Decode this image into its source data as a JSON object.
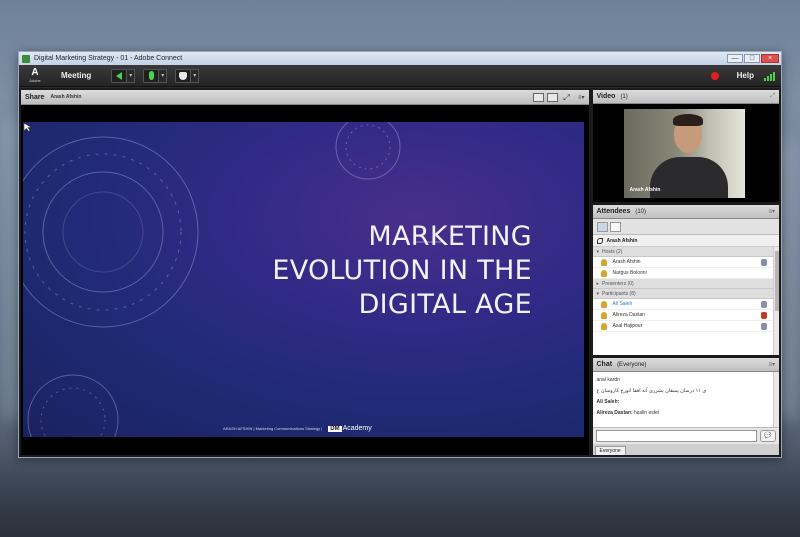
{
  "window": {
    "title": "Digital Marketing Strategy - 01 - Adobe Connect",
    "min_label": "—",
    "max_label": "□",
    "close_label": "×"
  },
  "menubar": {
    "adobe_mark": "A",
    "adobe_text": "Adobe",
    "meeting": "Meeting",
    "help": "Help",
    "record_color": "#e02020",
    "status_color": "#4dd04d"
  },
  "share": {
    "title": "Share",
    "presenter": "Arash Afshin",
    "menu_glyph": "≡▾"
  },
  "slide": {
    "title_lines": [
      "MARKETING",
      "EVOLUTION IN THE",
      "DIGITAL AGE"
    ],
    "footer": "ARASH AFSHIN | Marketing Communications Strategy |",
    "logo_box": "DM",
    "logo_text": "Academy",
    "bg_color": "#2f2a86"
  },
  "video": {
    "title": "Video",
    "count": "(1)",
    "name": "Arash Afshin"
  },
  "attendees": {
    "title": "Attendees",
    "count": "(10)",
    "me": "Arash Afshin",
    "groups": {
      "hosts": "Hosts (2)",
      "presenters": "Presenters (0)",
      "participants": "Participants (8)"
    },
    "hosts": [
      "Arash Afshin",
      "Nargus Bolooni"
    ],
    "participants": [
      "Ali Saleh",
      "Alireza Dastan",
      "Asal Hajipour"
    ]
  },
  "chat": {
    "title": "Chat",
    "scope": "(Everyone)",
    "messages": [
      {
        "who": "",
        "text": "anal kardn"
      },
      {
        "who": "",
        "text": "ی ۱۱ درسان پسقان بشرزی آنه افقا اتورخ کاروسان ع"
      },
      {
        "who": "Ali Saleh:",
        "text": ""
      },
      {
        "who": "Alireza Dastan:",
        "text": "haslin estel"
      }
    ],
    "input_value": "",
    "tab": "Everyone"
  }
}
